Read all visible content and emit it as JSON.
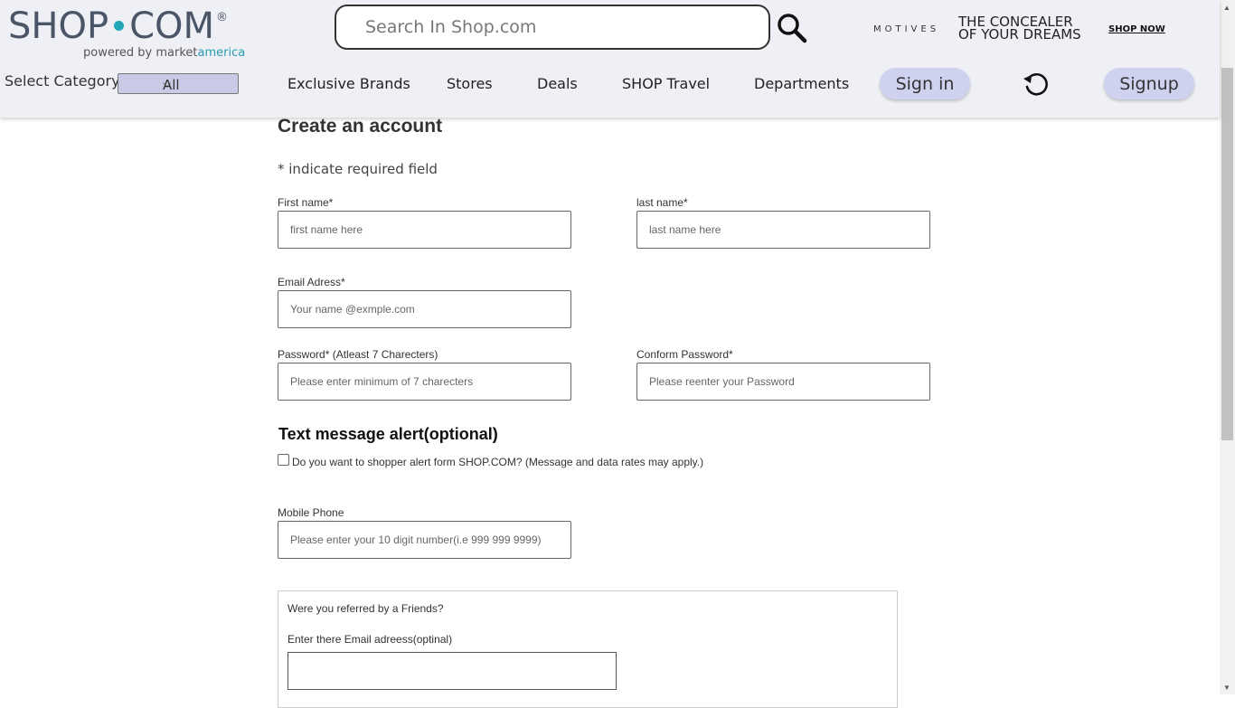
{
  "header": {
    "logo": {
      "left": "SHOP",
      "right": "COM",
      "registered": "®"
    },
    "tagline": {
      "prefix": "powered by ",
      "brand_market": "market",
      "brand_america": "america"
    },
    "search": {
      "placeholder": "Search In Shop.com",
      "value": ""
    },
    "ad": {
      "brand": "MOTIVES",
      "tag_line1": "THE CONCEALER",
      "tag_line2": "OF YOUR DREAMS",
      "cta": "SHOP NOW"
    },
    "category": {
      "label": "Select Category",
      "selected": "All"
    },
    "nav": [
      "Exclusive Brands",
      "Stores",
      "Deals",
      "SHOP Travel",
      "Departments"
    ],
    "signin_label": "Sign in",
    "signup_label": "Signup"
  },
  "form": {
    "title": "Create an account",
    "required_note": "* indicate required field",
    "first_name": {
      "label": "First name*",
      "placeholder": "first name here"
    },
    "last_name": {
      "label": "last name*",
      "placeholder": "last name here"
    },
    "email": {
      "label": "Email Adress*",
      "placeholder": "Your name @exmple.com"
    },
    "password": {
      "label": "Password* (Atleast 7 Charecters)",
      "placeholder": "Please enter minimum of 7 charecters"
    },
    "confirm_password": {
      "label": "Conform Password*",
      "placeholder": "Please reenter your Password"
    },
    "sms_title": "Text message alert(optional)",
    "sms_checkbox_label": "Do you want to shopper alert form SHOP.COM? (Message and data rates may apply.)",
    "mobile": {
      "label": "Mobile Phone",
      "placeholder": "Please enter your 10 digit number(i.e 999 999 9999)"
    },
    "referral": {
      "question": "Were you referred by a Friends?",
      "email_label": "Enter there Email adreess(optinal)",
      "email_value": ""
    }
  },
  "colors": {
    "header_bg": "#eef0f6",
    "pill_bg": "#cfd2ee",
    "brand_teal": "#22a7b8"
  }
}
